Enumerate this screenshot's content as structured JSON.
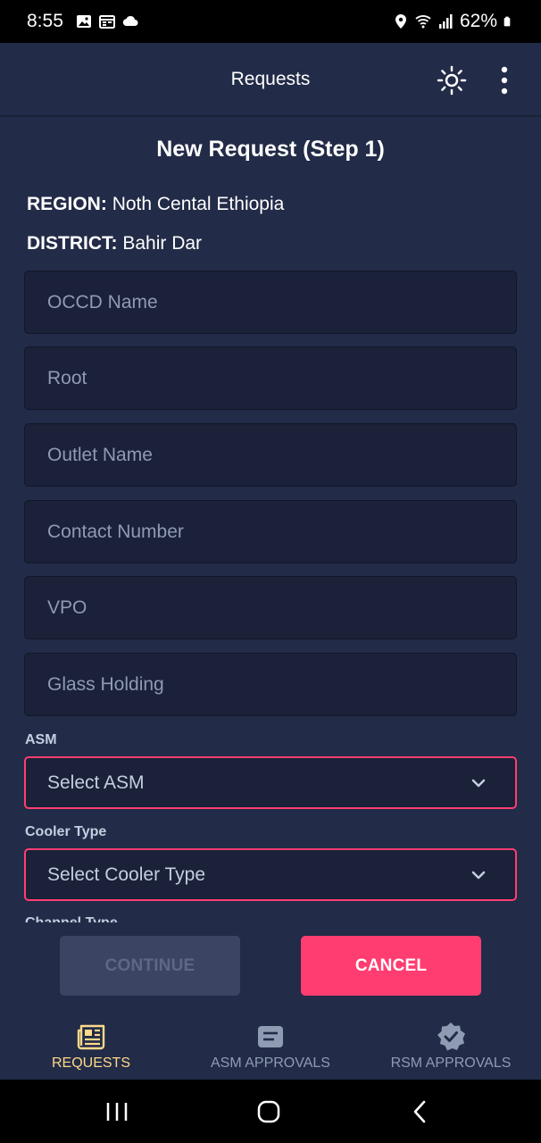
{
  "status_bar": {
    "time": "8:55",
    "battery": "62%"
  },
  "app_bar": {
    "title": "Requests",
    "theme_icon": "sun-icon",
    "menu_icon": "more-vertical-icon"
  },
  "form": {
    "heading": "New Request (Step 1)",
    "region_label": "REGION:",
    "region_value": "Noth Cental Ethiopia",
    "district_label": "DISTRICT:",
    "district_value": "Bahir Dar",
    "fields": [
      {
        "placeholder": "OCCD Name"
      },
      {
        "placeholder": "Root"
      },
      {
        "placeholder": "Outlet Name"
      },
      {
        "placeholder": "Contact Number"
      },
      {
        "placeholder": "VPO"
      },
      {
        "placeholder": "Glass Holding"
      }
    ],
    "asm_label": "ASM",
    "asm_placeholder": "Select ASM",
    "cooler_label": "Cooler Type",
    "cooler_placeholder": "Select Cooler Type",
    "channel_label": "Channel Type"
  },
  "actions": {
    "continue_label": "CONTINUE",
    "cancel_label": "CANCEL"
  },
  "bottom_nav": {
    "items": [
      {
        "label": "REQUESTS",
        "icon": "newspaper-icon",
        "active": true
      },
      {
        "label": "ASM APPROVALS",
        "icon": "message-square-icon",
        "active": false
      },
      {
        "label": "RSM APPROVALS",
        "icon": "verified-badge-icon",
        "active": false
      }
    ]
  },
  "colors": {
    "background": "#222b47",
    "field_background": "#1a2138",
    "danger": "#ff3d71",
    "active_nav": "#ffd98a",
    "hint": "#8f9bb3"
  }
}
